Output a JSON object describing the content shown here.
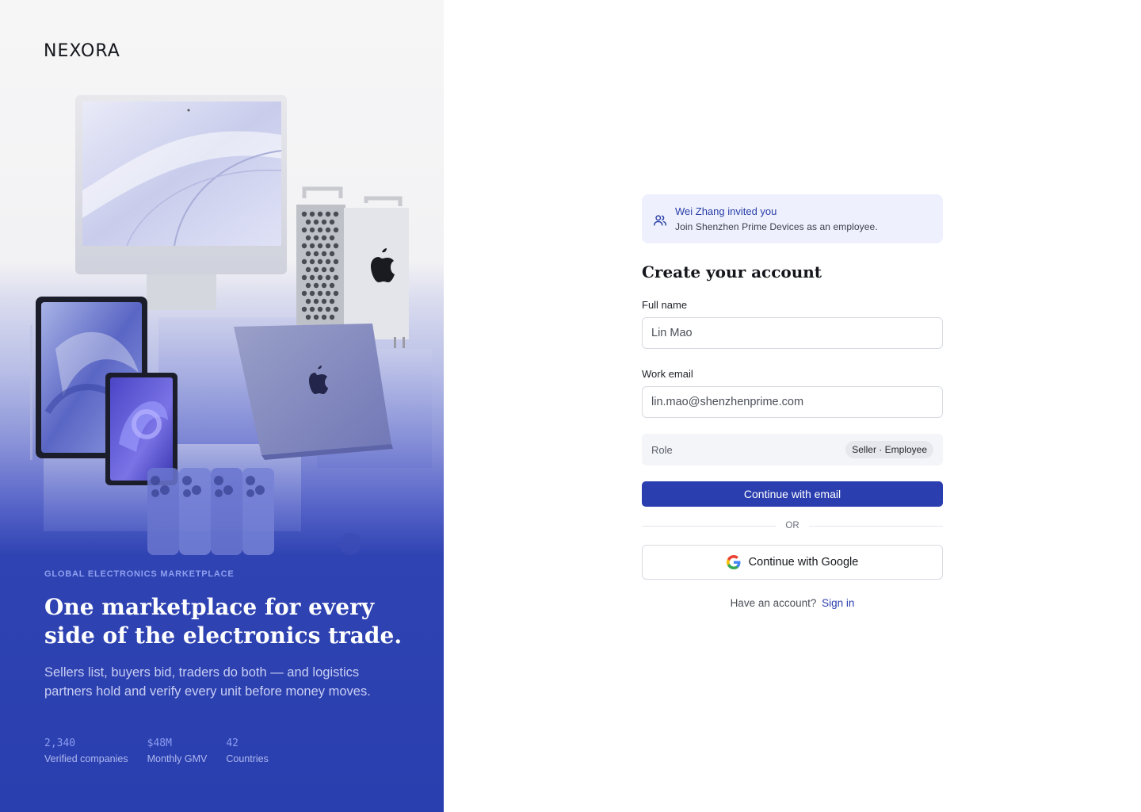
{
  "brand": {
    "name": "NEXORA"
  },
  "hero": {
    "eyebrow": "GLOBAL ELECTRONICS MARKETPLACE",
    "headline": "One marketplace for every side of the electronics trade.",
    "subcopy": "Sellers list, buyers bid, traders do both — and logistics partners hold and verify every unit before money moves.",
    "stats": [
      {
        "value": "2,340",
        "label": "Verified companies"
      },
      {
        "value": "$48M",
        "label": "Monthly GMV"
      },
      {
        "value": "42",
        "label": "Countries"
      }
    ],
    "image_icons": [
      "imac",
      "mac-pro",
      "macbook",
      "ipad",
      "iphone"
    ]
  },
  "invite": {
    "icon": "users-icon",
    "title": "Wei Zhang invited you",
    "body": "Join Shenzhen Prime Devices as an employee."
  },
  "form": {
    "title": "Create your account",
    "full_name": {
      "label": "Full name",
      "value": "Lin Mao"
    },
    "work_email": {
      "label": "Work email",
      "value": "lin.mao@shenzhenprime.com"
    },
    "role": {
      "label": "Role",
      "value": "Seller · Employee"
    },
    "continue_email_label": "Continue with email",
    "divider_label": "OR",
    "continue_google_label": "Continue with Google",
    "signin_prompt": "Have an account?",
    "signin_link": "Sign in"
  },
  "colors": {
    "primary": "#2a3eaf",
    "hero_bottom": "#2a3faf",
    "invite_bg": "#eef1fd",
    "accent_text": "#8fa0f0"
  }
}
